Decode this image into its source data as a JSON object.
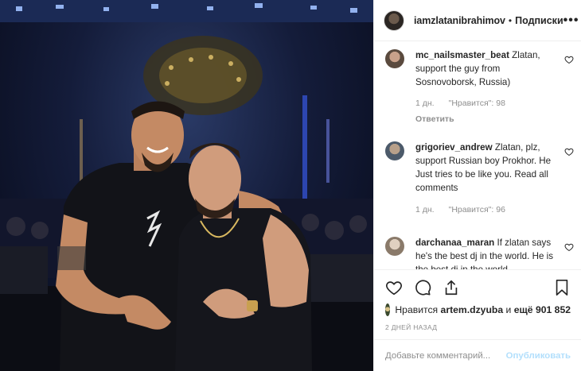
{
  "header": {
    "username": "iamzlatanibrahimov",
    "dot": "•",
    "follow_label": "Подписки",
    "more_label": "•••"
  },
  "comments": [
    {
      "username": "mc_nailsmaster_beat",
      "text": "Zlatan, support the guy from Sosnovoborsk, Russia)",
      "time": "1 дн.",
      "likes": "\"Нравится\": 98",
      "reply": "Ответить",
      "avatar_color": "#8b6b5a"
    },
    {
      "username": "grigoriev_andrew",
      "text": "Zlatan, plz, support Russian boy Prokhor. He Just tries to be like you. Read all comments",
      "time": "1 дн.",
      "likes": "\"Нравится\": 96",
      "reply": "",
      "avatar_color": "#7a6a58"
    },
    {
      "username": "darchanaa_maran",
      "text": "If zlatan says he's the best dj in the world. He is the best dj in the world",
      "time": "",
      "likes": "",
      "reply": "",
      "avatar_color": "#a89a8a"
    }
  ],
  "actions": {
    "likes_prefix": "Нравится",
    "likes_user": "artem.dzyuba",
    "likes_and": "и",
    "likes_count": "ещё 901 852",
    "date": "2 ДНЕЙ НАЗАД"
  },
  "add_comment": {
    "placeholder": "Добавьте комментарий...",
    "publish_label": "Опубликовать"
  },
  "colors": {
    "accent_disabled": "#b2dffc",
    "muted": "#8e8e8e",
    "text": "#262626",
    "border": "#efefef"
  }
}
